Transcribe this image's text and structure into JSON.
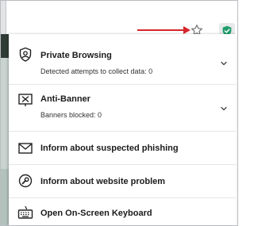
{
  "colors": {
    "accent_arrow": "#d7262b",
    "shield": "#1e9e6a"
  },
  "toolbar": {
    "bookmark_icon": "star-outline-icon",
    "extension_icon": "shield-check-icon"
  },
  "menu": {
    "items": [
      {
        "title": "Private Browsing",
        "subtitle": "Detected attempts to collect data: 0",
        "icon": "private-browsing-icon",
        "expandable": true
      },
      {
        "title": "Anti-Banner",
        "subtitle": "Banners blocked: 0",
        "icon": "anti-banner-icon",
        "expandable": true
      },
      {
        "title": "Inform about suspected phishing",
        "icon": "envelope-icon"
      },
      {
        "title": "Inform about website problem",
        "icon": "website-problem-icon"
      },
      {
        "title": "Open On-Screen Keyboard",
        "icon": "keyboard-icon"
      }
    ]
  }
}
